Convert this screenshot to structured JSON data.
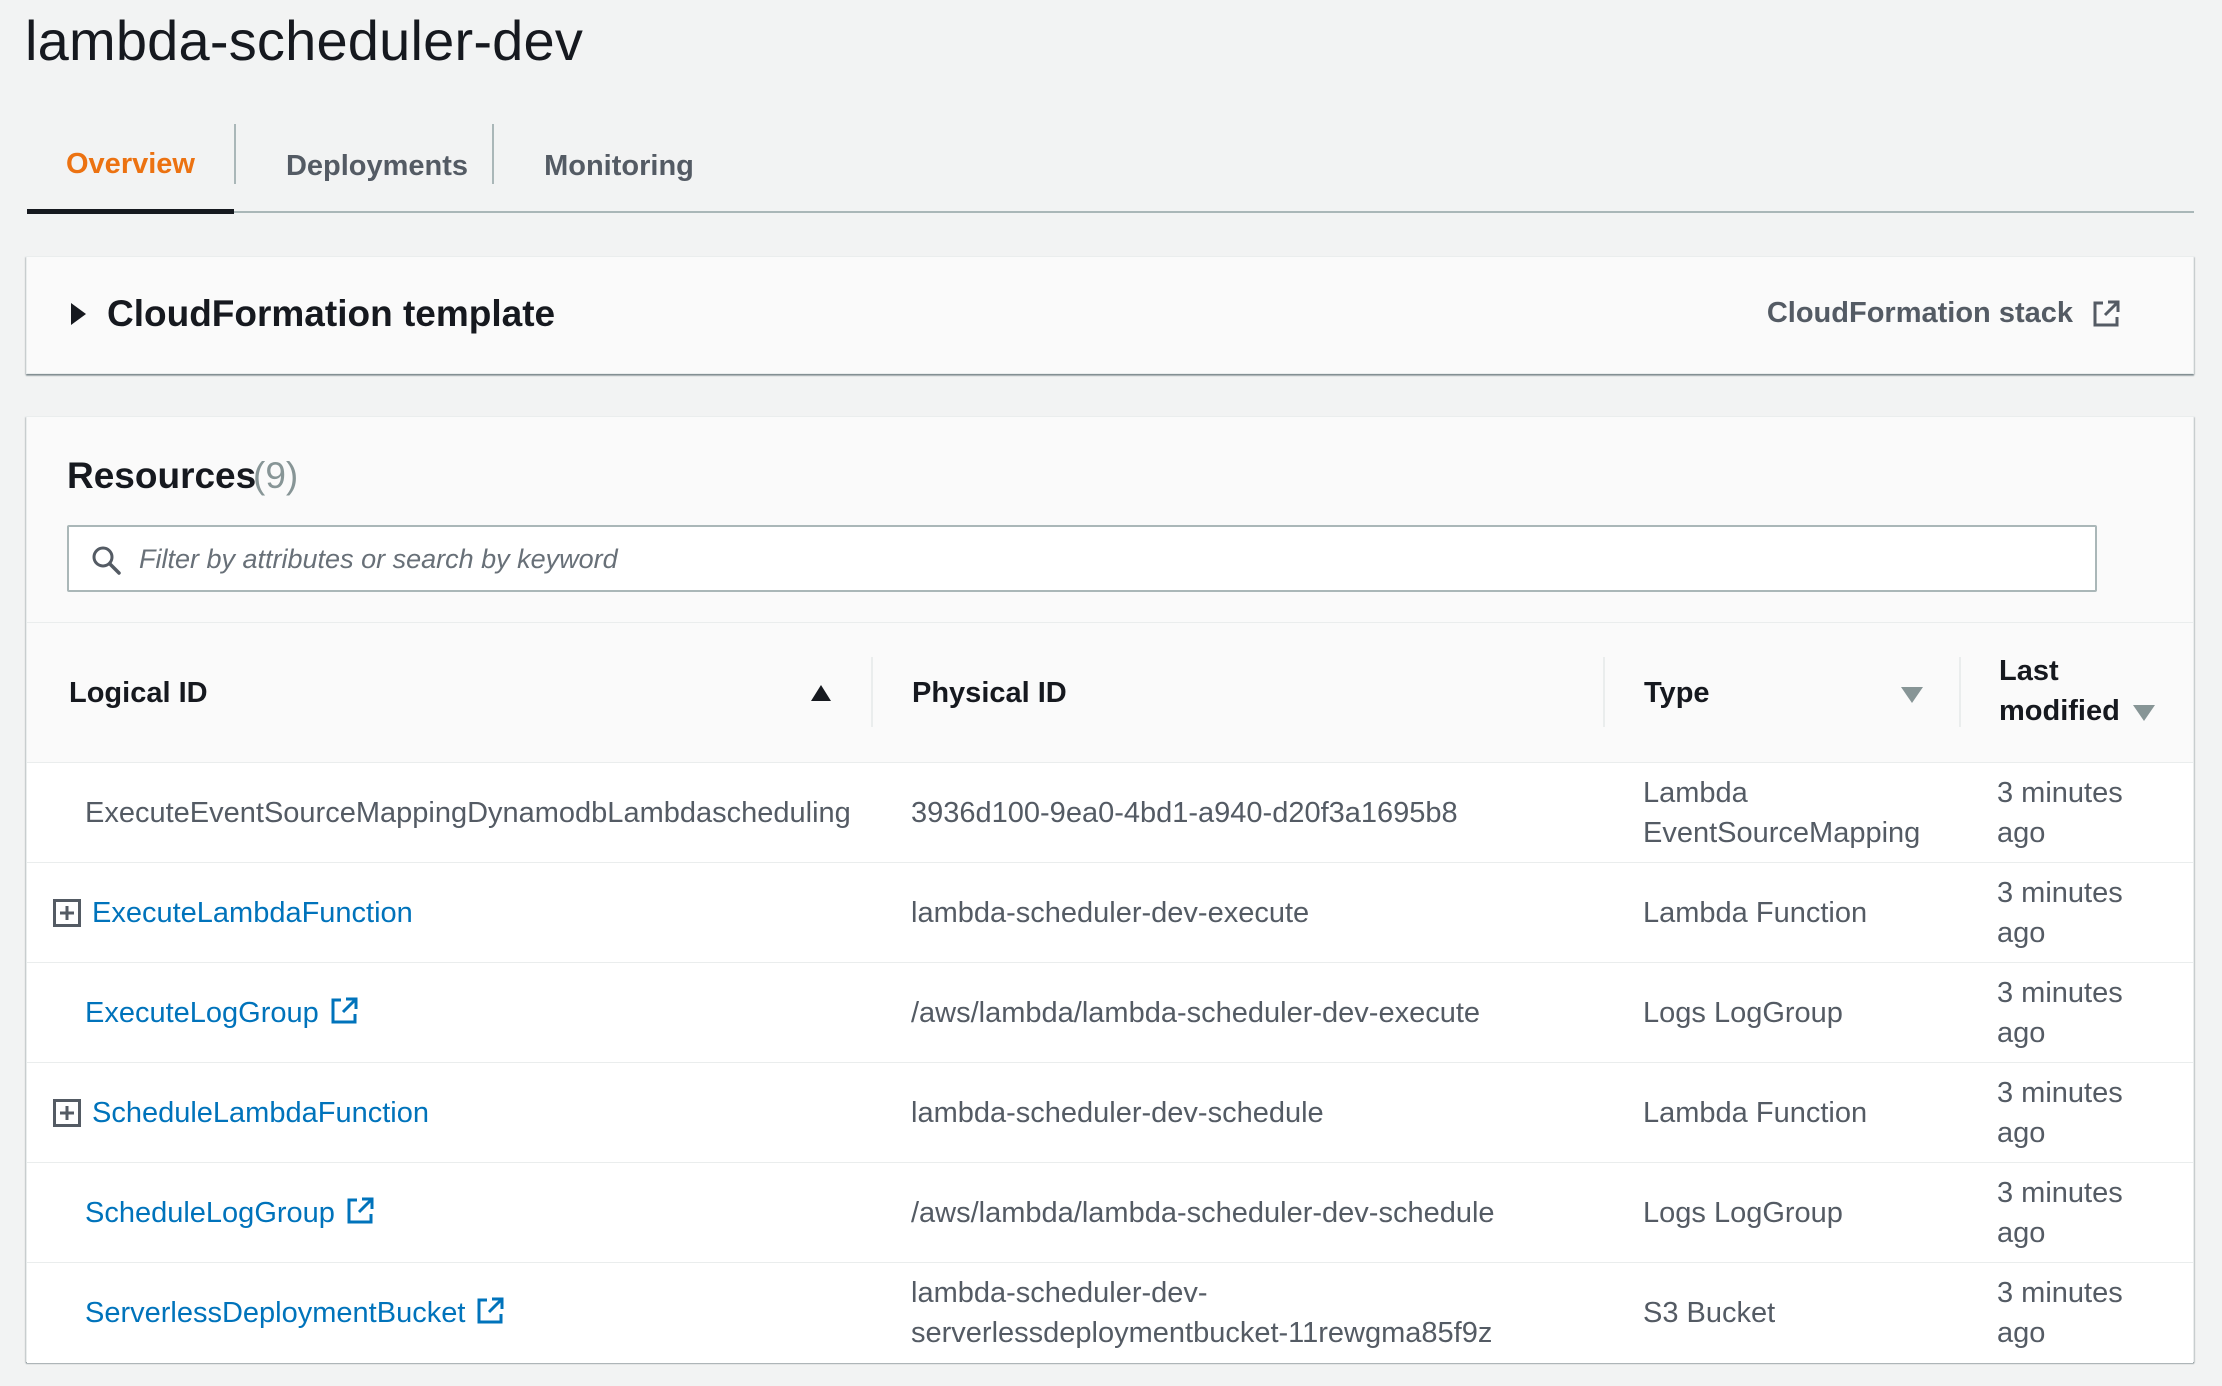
{
  "page": {
    "title": "lambda-scheduler-dev"
  },
  "tabs": [
    {
      "label": "Overview",
      "active": true
    },
    {
      "label": "Deployments",
      "active": false
    },
    {
      "label": "Monitoring",
      "active": false
    }
  ],
  "cloudformation": {
    "title": "CloudFormation template",
    "stack_link": "CloudFormation stack",
    "caret_icon": "caret-right-icon",
    "external_icon": "external-link-icon"
  },
  "resources": {
    "title": "Resources",
    "count": "(9)",
    "search_placeholder": "Filter by attributes or search by keyword",
    "columns": {
      "logical_id": "Logical ID",
      "physical_id": "Physical ID",
      "type": "Type",
      "last_modified_line1": "Last",
      "last_modified_line2": "modified"
    },
    "rows": [
      {
        "logical_id": "ExecuteEventSourceMappingDynamodbLambdascheduling",
        "logical_link": false,
        "expandable": false,
        "external": false,
        "physical_id_line1": "3936d100-9ea0-4bd1-a940-d20f3a1695b8",
        "physical_id_line2": "",
        "type_line1": "Lambda",
        "type_line2": "EventSourceMapping",
        "modified_line1": "3 minutes",
        "modified_line2": "ago"
      },
      {
        "logical_id": "ExecuteLambdaFunction",
        "logical_link": true,
        "expandable": true,
        "external": false,
        "physical_id_line1": "lambda-scheduler-dev-execute",
        "physical_id_line2": "",
        "type_line1": "Lambda Function",
        "type_line2": "",
        "modified_line1": "3 minutes",
        "modified_line2": "ago"
      },
      {
        "logical_id": "ExecuteLogGroup",
        "logical_link": true,
        "expandable": false,
        "external": true,
        "physical_id_line1": "/aws/lambda/lambda-scheduler-dev-execute",
        "physical_id_line2": "",
        "type_line1": "Logs LogGroup",
        "type_line2": "",
        "modified_line1": "3 minutes",
        "modified_line2": "ago"
      },
      {
        "logical_id": "ScheduleLambdaFunction",
        "logical_link": true,
        "expandable": true,
        "external": false,
        "physical_id_line1": "lambda-scheduler-dev-schedule",
        "physical_id_line2": "",
        "type_line1": "Lambda Function",
        "type_line2": "",
        "modified_line1": "3 minutes",
        "modified_line2": "ago"
      },
      {
        "logical_id": "ScheduleLogGroup",
        "logical_link": true,
        "expandable": false,
        "external": true,
        "physical_id_line1": "/aws/lambda/lambda-scheduler-dev-schedule",
        "physical_id_line2": "",
        "type_line1": "Logs LogGroup",
        "type_line2": "",
        "modified_line1": "3 minutes",
        "modified_line2": "ago"
      },
      {
        "logical_id": "ServerlessDeploymentBucket",
        "logical_link": true,
        "expandable": false,
        "external": true,
        "physical_id_line1": "lambda-scheduler-dev-",
        "physical_id_line2": "serverlessdeploymentbucket-11rewgma85f9z",
        "type_line1": "S3 Bucket",
        "type_line2": "",
        "modified_line1": "3 minutes",
        "modified_line2": "ago"
      }
    ]
  },
  "colors": {
    "accent": "#ec7211",
    "link": "#0073bb",
    "text": "#16191f",
    "muted": "#545b64",
    "background": "#f2f3f3"
  }
}
